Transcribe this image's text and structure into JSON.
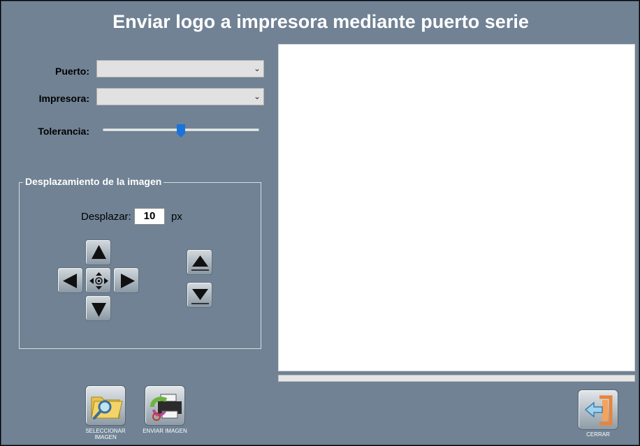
{
  "window": {
    "title": "Enviar logo a impresora mediante puerto serie"
  },
  "form": {
    "puerto_label": "Puerto:",
    "puerto_value": "",
    "impresora_label": "Impresora:",
    "impresora_value": "",
    "tolerancia_label": "Tolerancia:",
    "tolerancia_level": 0.5
  },
  "offset_group": {
    "legend": "Desplazamiento de la imagen",
    "desplazar_label": "Desplazar:",
    "desplazar_value": "10",
    "unit": "px"
  },
  "actions": {
    "select_image": "SELECCIONAR IMAGEN",
    "send_image": "ENVIAR IMAGEN",
    "close": "CERRAR"
  },
  "progress": {
    "value": 0
  },
  "colors": {
    "window_bg": "#708294",
    "slider_thumb": "#1a73d9",
    "close_accent": "#e8843a"
  },
  "icons": {
    "up": "arrow-up-icon",
    "down": "arrow-down-icon",
    "left": "arrow-left-icon",
    "right": "arrow-right-icon",
    "center": "center-icon",
    "select": "folder-search-icon",
    "send": "printer-send-icon",
    "close": "exit-door-icon"
  }
}
